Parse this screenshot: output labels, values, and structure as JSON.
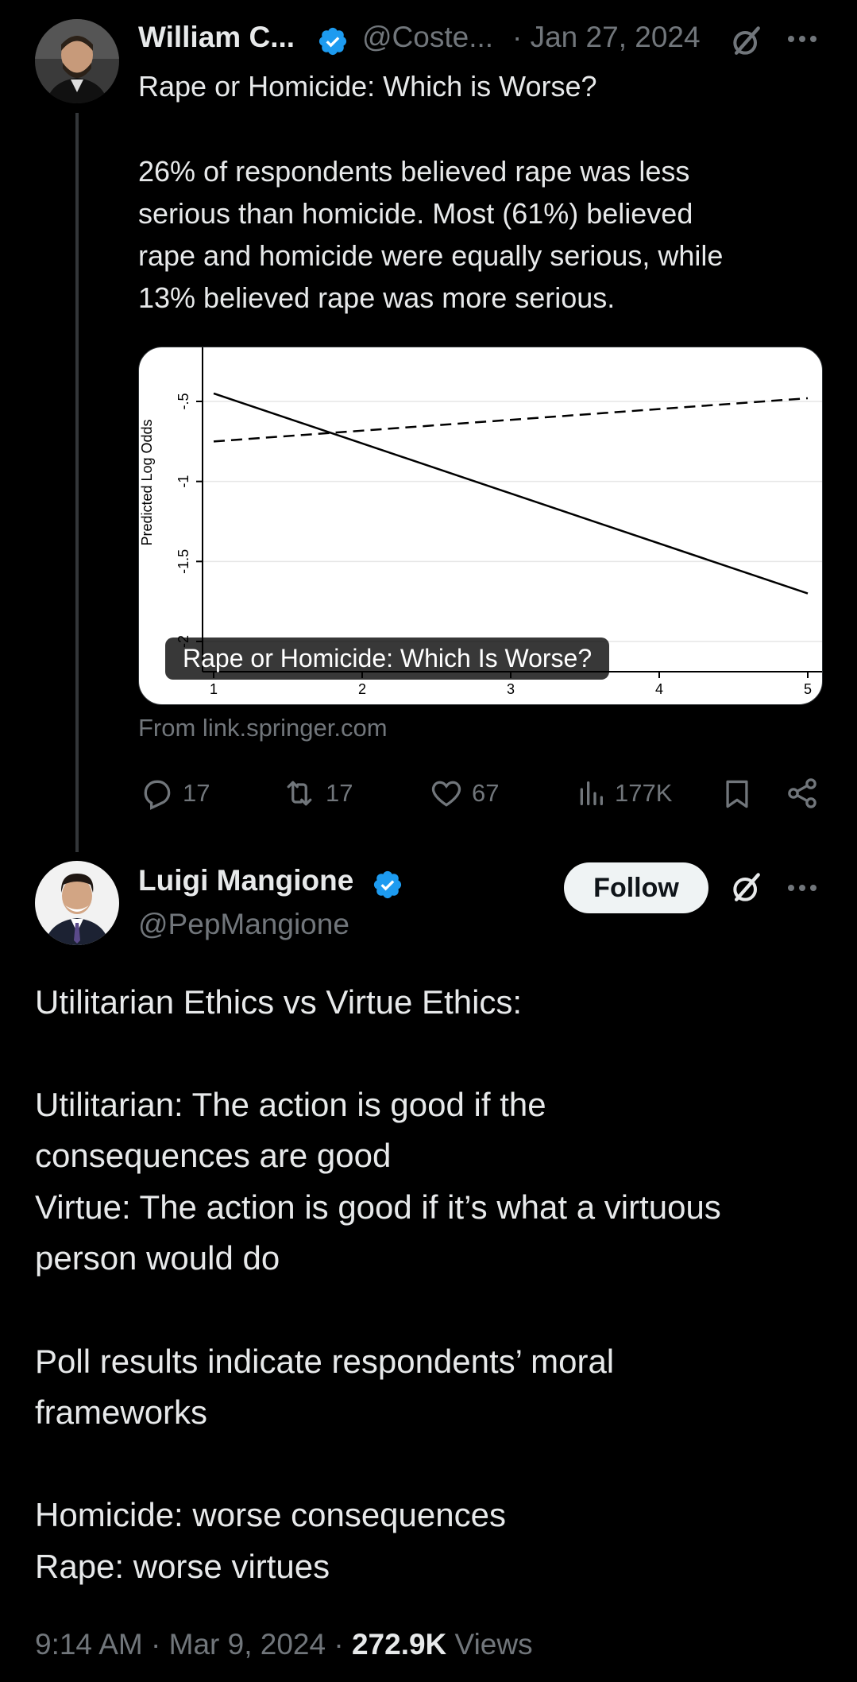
{
  "tweet1": {
    "author_name": "William C...",
    "handle": "@Coste...",
    "date": "· Jan 27, 2024",
    "title_line": "Rape or Homicide: Which is Worse?",
    "body_lines": [
      "26% of respondents believed rape was less",
      "serious than homicide. Most (61%) believed",
      "rape and homicide were equally serious, while",
      "13% believed rape was more serious."
    ],
    "card": {
      "title": "Rape or Homicide: Which Is Worse?",
      "source": "From link.springer.com"
    },
    "actions": {
      "replies": "17",
      "reposts": "17",
      "likes": "67",
      "views": "177K"
    }
  },
  "chart_data": {
    "type": "line",
    "title": "",
    "xlabel": "",
    "ylabel": "Predicted Log Odds",
    "x_ticks": [
      "1",
      "2",
      "3",
      "4",
      "5"
    ],
    "y_ticks": [
      "-.5",
      "-1",
      "-1.5",
      "-2"
    ],
    "xlim": [
      0.9,
      5.1
    ],
    "ylim": [
      -2.2,
      -0.3
    ],
    "series": [
      {
        "name": "",
        "style": "solid",
        "x": [
          1,
          5
        ],
        "y": [
          -0.45,
          -1.7
        ]
      },
      {
        "name": "",
        "style": "dashed",
        "x": [
          1,
          5
        ],
        "y": [
          -0.75,
          -0.48
        ]
      }
    ]
  },
  "tweet2": {
    "author_name": "Luigi Mangione",
    "handle": "@PepMangione",
    "follow_label": "Follow",
    "lines": [
      "Utilitarian Ethics vs Virtue Ethics:",
      "",
      "Utilitarian: The action is good if the",
      "consequences are good",
      "Virtue: The action is good if it’s what a virtuous",
      "person would do",
      "",
      "Poll results indicate respondents’ moral",
      "frameworks",
      "",
      "Homicide: worse consequences",
      "Rape: worse virtues"
    ],
    "footer": {
      "time_date": "9:14 AM · Mar 9, 2024 · ",
      "views_count": "272.9K",
      "views_label": " Views"
    }
  },
  "colors": {
    "background": "#000000",
    "text": "#e7e9ea",
    "muted": "#71767b",
    "verified": "#1d9bf0"
  }
}
